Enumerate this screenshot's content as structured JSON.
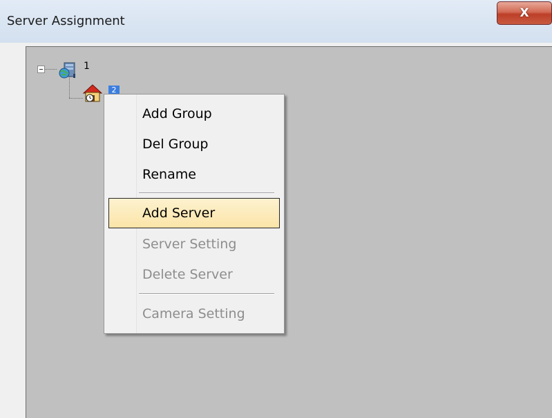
{
  "window": {
    "title": "Server Assignment",
    "close_glyph": "X"
  },
  "tree": {
    "root": {
      "label": "1",
      "icon": "server-group-icon",
      "expanded": true
    },
    "child": {
      "label": "2",
      "icon": "house-icon",
      "selected": true
    }
  },
  "context_menu": {
    "items": [
      {
        "label": "Add Group",
        "enabled": true
      },
      {
        "label": "Del Group",
        "enabled": true
      },
      {
        "label": "Rename",
        "enabled": true
      },
      {
        "label": "Add Server",
        "enabled": true,
        "highlighted": true
      },
      {
        "label": "Server Setting",
        "enabled": false
      },
      {
        "label": "Delete Server",
        "enabled": false
      },
      {
        "label": "Camera Setting",
        "enabled": false
      }
    ]
  },
  "colors": {
    "tree_background": "#c0c0c0",
    "highlight_fill": "#fbe4a8",
    "selection_blue": "#3b7ee0",
    "disabled_text": "#8d8d8d"
  }
}
